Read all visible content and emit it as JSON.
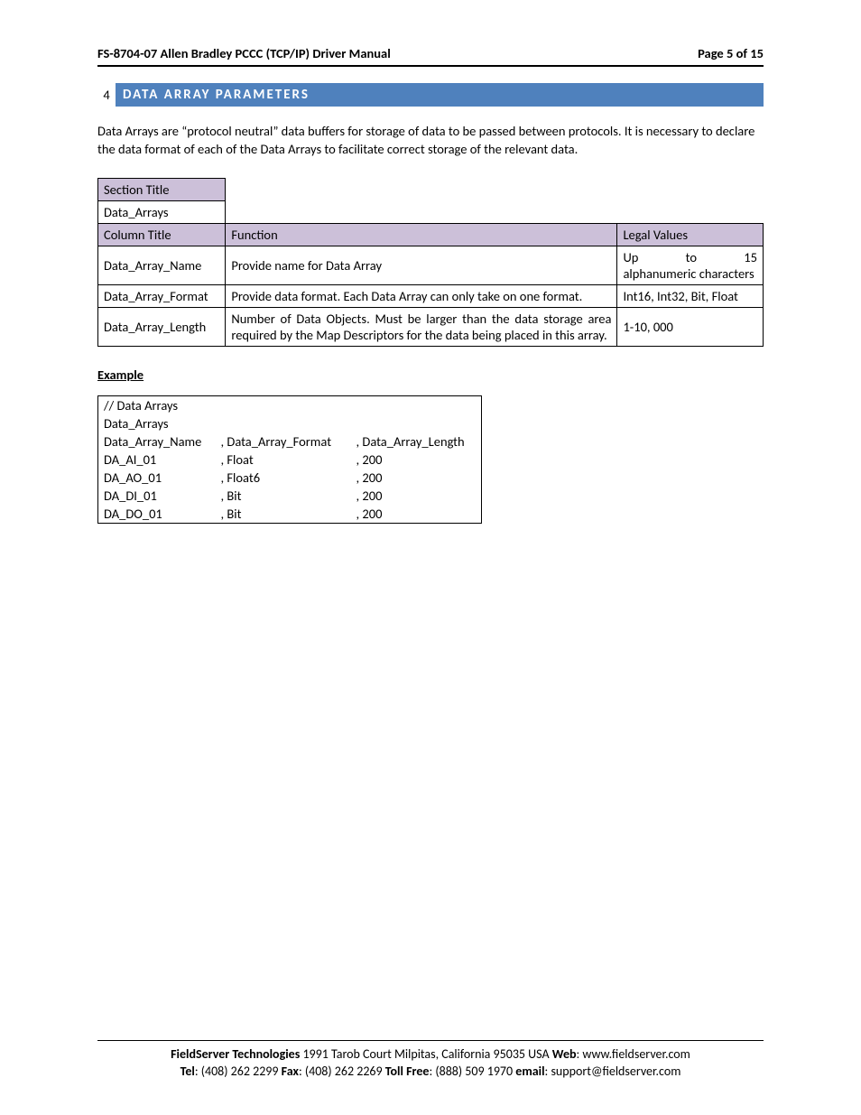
{
  "header": {
    "doc_title": "FS-8704-07 Allen Bradley PCCC (TCP/IP) Driver Manual",
    "page_label": "Page 5 of 15"
  },
  "section": {
    "number": "4",
    "title": "DATA ARRAY PARAMETERS"
  },
  "intro": "Data Arrays are “protocol neutral” data buffers for storage of data to be passed between protocols.  It is necessary to declare the data format of each of the Data Arrays to facilitate correct storage of the relevant data.",
  "params": {
    "section_title_label": "Section Title",
    "section_title_value": "Data_Arrays",
    "col_label": "Column Title",
    "func_label": "Function",
    "legal_label": "Legal Values",
    "rows": [
      {
        "name": "Data_Array_Name",
        "func": "Provide name for Data Array",
        "legal_pre": "Up",
        "legal_mid": "to",
        "legal_post": "15",
        "legal_rest": "alphanumeric characters"
      },
      {
        "name": "Data_Array_Format",
        "func": "Provide data format. Each Data Array can only take on one format.",
        "legal": "Int16, Int32, Bit, Float"
      },
      {
        "name": "Data_Array_Length",
        "func": "Number of Data Objects. Must be larger than the data storage area required by the Map Descriptors for the data being placed in this array.",
        "legal": "1-10, 000"
      }
    ]
  },
  "example_header": "Example",
  "example": {
    "comment": "//    Data Arrays",
    "section": "Data_Arrays",
    "headers": {
      "a": "Data_Array_Name",
      "b": ", Data_Array_Format",
      "c": ", Data_Array_Length"
    },
    "rows": [
      {
        "a": "DA_AI_01",
        "b": ", Float",
        "c": ", 200"
      },
      {
        "a": "DA_AO_01",
        "b": ", Float6",
        "c": ", 200"
      },
      {
        "a": "DA_DI_01",
        "b": ", Bit",
        "c": ", 200"
      },
      {
        "a": "DA_DO_01",
        "b": ", Bit",
        "c": ", 200"
      }
    ]
  },
  "footer": {
    "company": "FieldServer Technologies",
    "addr": " 1991 Tarob Court Milpitas, California 95035 USA   ",
    "web_label": "Web",
    "web": ": www.fieldserver.com",
    "tel_label": "Tel",
    "tel": ": (408) 262 2299   ",
    "fax_label": "Fax",
    "fax": ": (408) 262 2269   ",
    "tollfree_label": "Toll Free",
    "tollfree": ": (888) 509 1970   ",
    "email_label": "email",
    "email": ": support@fieldserver.com"
  }
}
